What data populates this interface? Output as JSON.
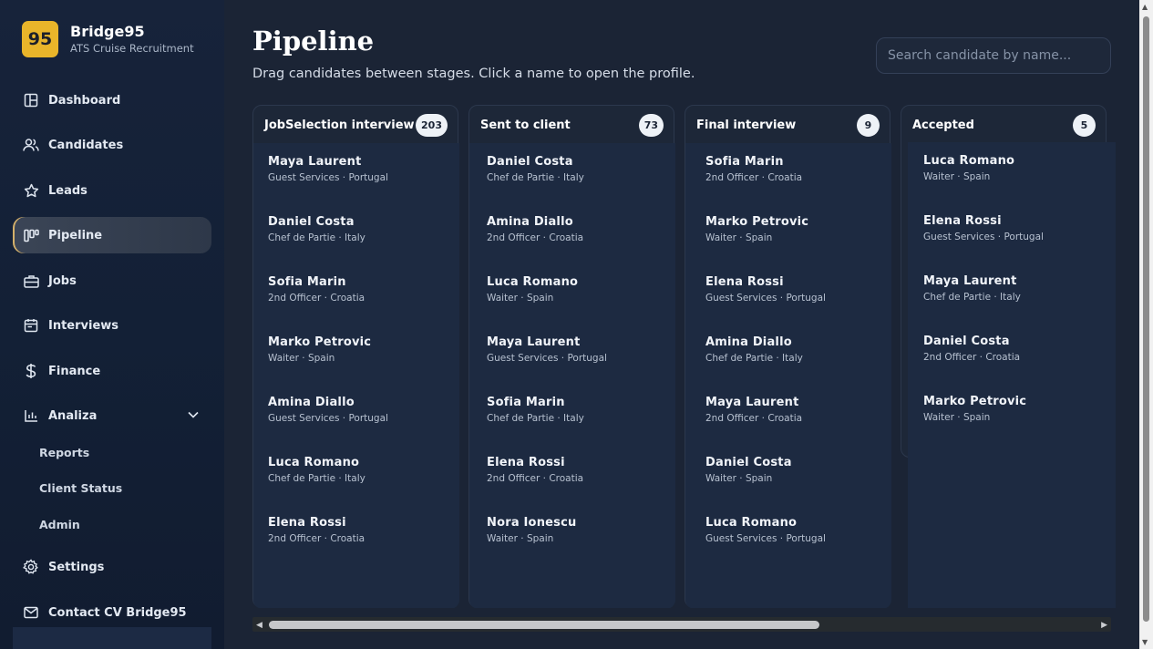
{
  "brand": {
    "logo_text": "95",
    "name": "Bridge95",
    "subtitle": "ATS Cruise Recruitment"
  },
  "sidebar": {
    "items": [
      {
        "label": "Dashboard",
        "icon": "dashboard-icon"
      },
      {
        "label": "Candidates",
        "icon": "users-icon"
      },
      {
        "label": "Leads",
        "icon": "star-icon"
      },
      {
        "label": "Pipeline",
        "icon": "pipeline-icon",
        "active": true
      },
      {
        "label": "Jobs",
        "icon": "briefcase-icon"
      },
      {
        "label": "Interviews",
        "icon": "calendar-icon"
      },
      {
        "label": "Finance",
        "icon": "dollar-icon"
      },
      {
        "label": "Analiza",
        "icon": "bar-chart-icon",
        "expanded": true
      },
      {
        "label": "Settings",
        "icon": "gear-icon"
      },
      {
        "label": "Contact CV Bridge95",
        "icon": "mail-icon"
      }
    ],
    "subitems": [
      "Reports",
      "Client Status",
      "Admin"
    ]
  },
  "header": {
    "title": "Pipeline",
    "subtitle": "Drag candidates between stages. Click a name to open the profile.",
    "search_placeholder": "Search candidate by name..."
  },
  "columns": [
    {
      "title": "JobSelection interview",
      "count": "203",
      "cards": [
        {
          "name": "Maya Laurent",
          "meta": "Guest Services · Portugal"
        },
        {
          "name": "Daniel Costa",
          "meta": "Chef de Partie · Italy"
        },
        {
          "name": "Sofia Marin",
          "meta": "2nd Officer · Croatia"
        },
        {
          "name": "Marko Petrovic",
          "meta": "Waiter · Spain"
        },
        {
          "name": "Amina Diallo",
          "meta": "Guest Services · Portugal"
        },
        {
          "name": "Luca Romano",
          "meta": "Chef de Partie · Italy"
        },
        {
          "name": "Elena Rossi",
          "meta": "2nd Officer · Croatia"
        }
      ]
    },
    {
      "title": "Sent to client",
      "count": "73",
      "cards": [
        {
          "name": "Daniel Costa",
          "meta": "Chef de Partie · Italy"
        },
        {
          "name": "Amina Diallo",
          "meta": "2nd Officer · Croatia"
        },
        {
          "name": "Luca Romano",
          "meta": "Waiter · Spain"
        },
        {
          "name": "Maya Laurent",
          "meta": "Guest Services · Portugal"
        },
        {
          "name": "Sofia Marin",
          "meta": "Chef de Partie · Italy"
        },
        {
          "name": "Elena Rossi",
          "meta": "2nd Officer · Croatia"
        },
        {
          "name": "Nora Ionescu",
          "meta": "Waiter · Spain"
        }
      ]
    },
    {
      "title": "Final interview",
      "count": "9",
      "cards": [
        {
          "name": "Sofia Marin",
          "meta": "2nd Officer · Croatia"
        },
        {
          "name": "Marko Petrovic",
          "meta": "Waiter · Spain"
        },
        {
          "name": "Elena Rossi",
          "meta": "Guest Services · Portugal"
        },
        {
          "name": "Amina Diallo",
          "meta": "Chef de Partie · Italy"
        },
        {
          "name": "Maya Laurent",
          "meta": "2nd Officer · Croatia"
        },
        {
          "name": "Daniel Costa",
          "meta": "Waiter · Spain"
        },
        {
          "name": "Luca Romano",
          "meta": "Guest Services · Portugal"
        }
      ]
    },
    {
      "title": "Accepted",
      "count": "5",
      "cards": [
        {
          "name": "Luca Romano",
          "meta": "Waiter · Spain"
        },
        {
          "name": "Elena Rossi",
          "meta": "Guest Services · Portugal"
        },
        {
          "name": "Maya Laurent",
          "meta": "Chef de Partie · Italy"
        },
        {
          "name": "Daniel Costa",
          "meta": "2nd Officer · Croatia"
        },
        {
          "name": "Marko Petrovic",
          "meta": "Waiter · Spain"
        }
      ]
    }
  ],
  "colors": {
    "accent": "#e9b52a",
    "background": "#1b2435",
    "sidebar": "#132036",
    "card": "#1d2a41"
  }
}
